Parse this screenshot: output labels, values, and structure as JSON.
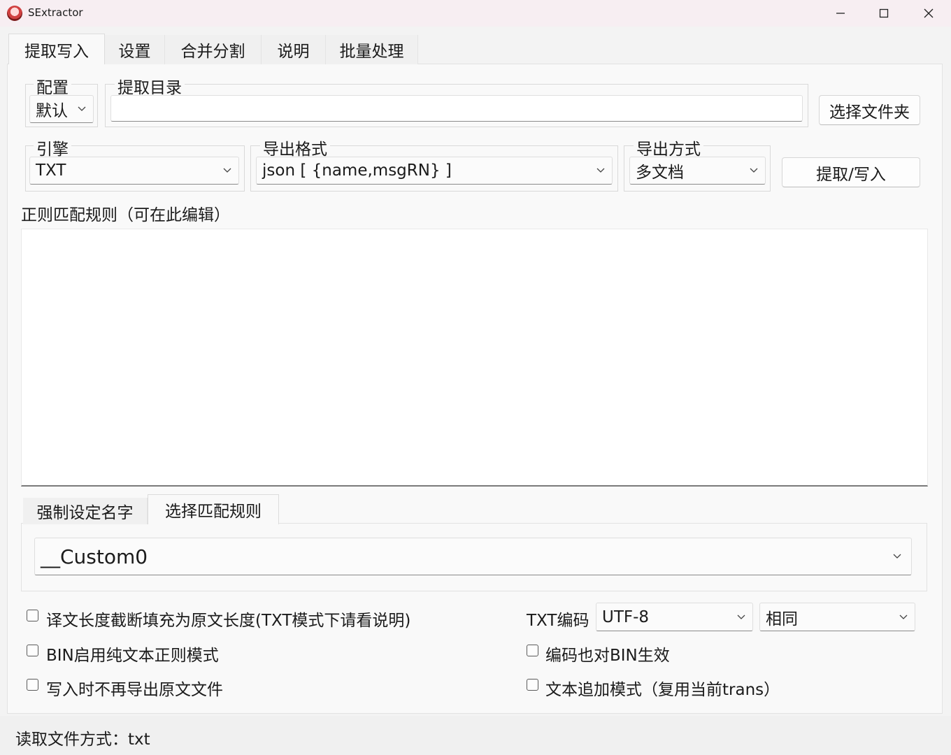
{
  "window": {
    "title": "SExtractor",
    "minimize_icon": "minimize-icon",
    "maximize_icon": "maximize-icon",
    "close_icon": "close-icon"
  },
  "tabs": [
    {
      "label": "提取写入",
      "active": true
    },
    {
      "label": "设置",
      "active": false
    },
    {
      "label": "合并分割",
      "active": false
    },
    {
      "label": "说明",
      "active": false
    },
    {
      "label": "批量处理",
      "active": false
    }
  ],
  "config": {
    "label": "配置",
    "value": "默认"
  },
  "extract_dir": {
    "label": "提取目录",
    "value": ""
  },
  "choose_folder_button": "选择文件夹",
  "engine": {
    "label": "引擎",
    "value": "TXT"
  },
  "export_format": {
    "label": "导出格式",
    "value": "json [ {name,msgRN} ]"
  },
  "export_mode": {
    "label": "导出方式",
    "value": "多文档"
  },
  "extract_write_button": "提取/写入",
  "regex": {
    "label": "正则匹配规则（可在此编辑）",
    "value": ""
  },
  "subtabs": [
    {
      "label": "强制设定名字",
      "active": false
    },
    {
      "label": "选择匹配规则",
      "active": true
    }
  ],
  "rule_select": {
    "value": "__Custom0"
  },
  "options_left": [
    {
      "label": "译文长度截断填充为原文长度(TXT模式下请看说明)",
      "checked": false
    },
    {
      "label": "BIN启用纯文本正则模式",
      "checked": false
    },
    {
      "label": "写入时不再导出原文文件",
      "checked": false
    }
  ],
  "txt_encoding": {
    "label": "TXT编码",
    "value": "UTF-8",
    "value2": "相同"
  },
  "options_right": [
    {
      "label": "编码也对BIN生效",
      "checked": false
    },
    {
      "label": "文本追加模式（复用当前trans）",
      "checked": false
    }
  ],
  "status": {
    "text": "读取文件方式：txt"
  }
}
